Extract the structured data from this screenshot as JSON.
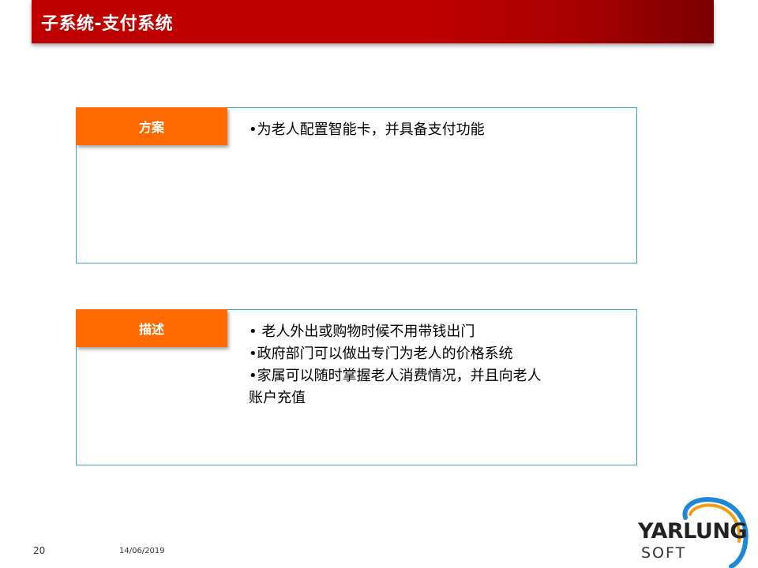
{
  "header": {
    "title": "子系统-支付系统"
  },
  "panels": [
    {
      "tag": "方案",
      "lines": [
        "•为老人配置智能卡，并具备支付功能"
      ]
    },
    {
      "tag": "描述",
      "lines": [
        "• 老人外出或购物时候不用带钱出门",
        "•政府部门可以做出专门为老人的价格系统",
        "•家属可以随时掌握老人消费情况，并且向老人",
        "账户充值"
      ]
    }
  ],
  "footer": {
    "page_number": "20",
    "date": "14/06/2019"
  },
  "logo": {
    "main": "YARLUNG",
    "sub": "SOFT",
    "icon": "yarlung-arc-logo-icon"
  },
  "colors": {
    "title_bar": "#c00000",
    "tag": "#ff6a00",
    "panel_border": "#3aa0d0"
  }
}
